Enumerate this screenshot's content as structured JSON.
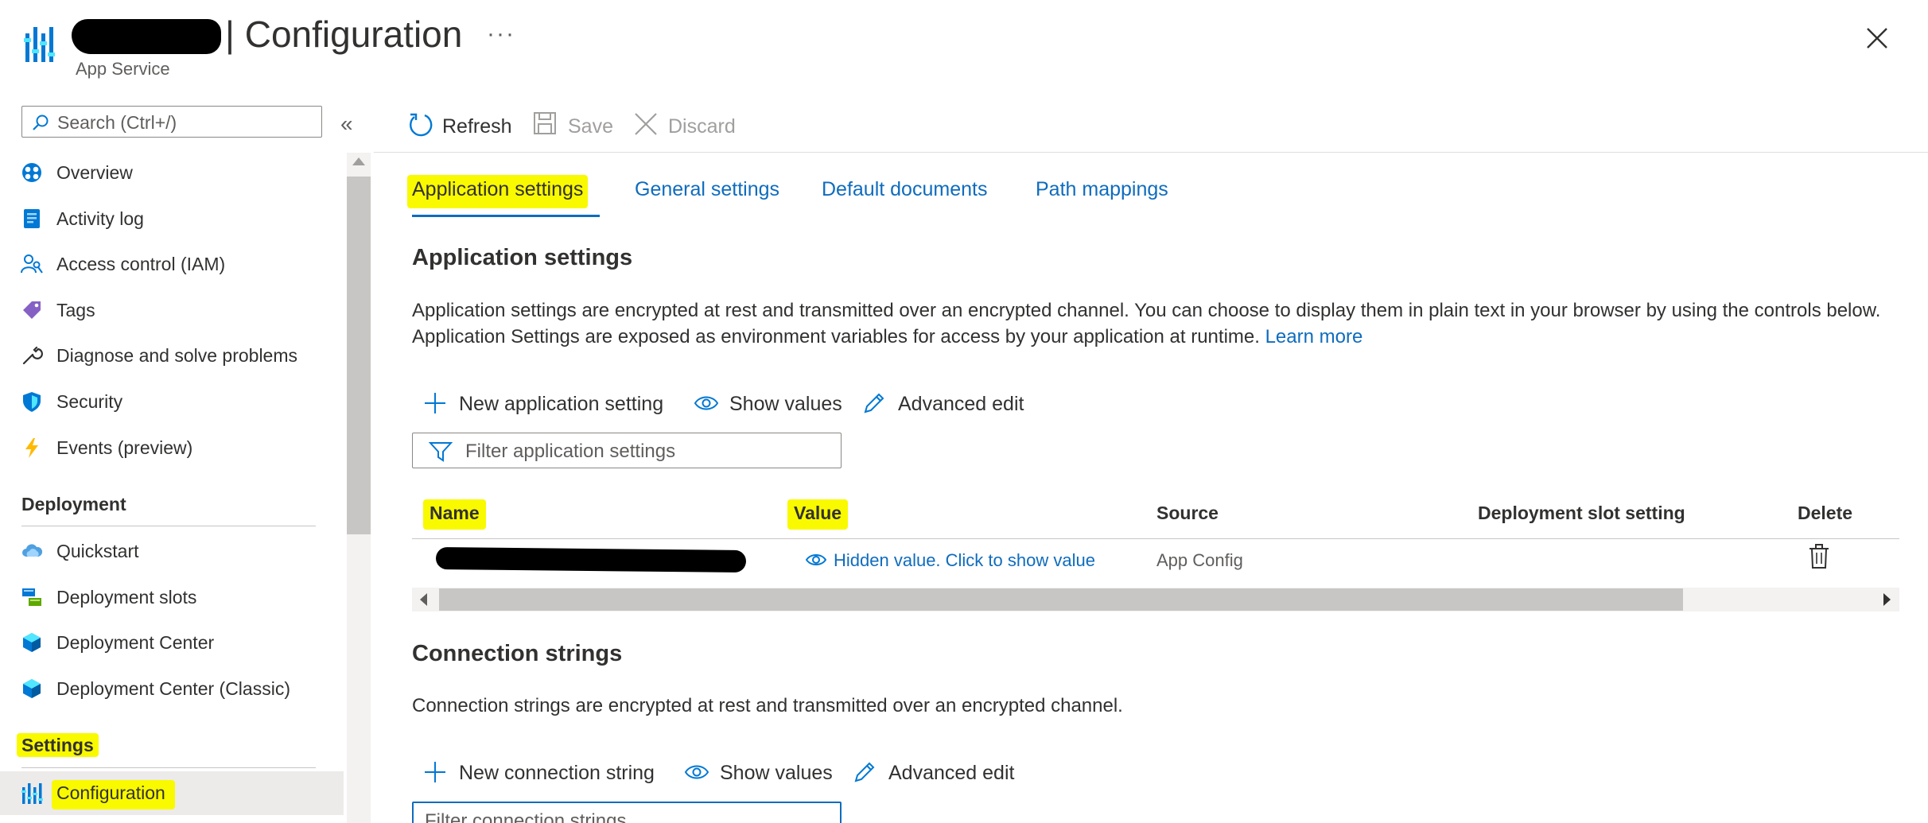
{
  "header": {
    "title": "| Configuration",
    "more": "···",
    "subtitle": "App Service"
  },
  "sidebar": {
    "search_placeholder": "Search (Ctrl+/)",
    "collapse": "«",
    "items": [
      {
        "label": "Overview",
        "icon": "overview-icon"
      },
      {
        "label": "Activity log",
        "icon": "activity-log-icon"
      },
      {
        "label": "Access control (IAM)",
        "icon": "iam-icon"
      },
      {
        "label": "Tags",
        "icon": "tag-icon"
      },
      {
        "label": "Diagnose and solve problems",
        "icon": "wrench-icon"
      },
      {
        "label": "Security",
        "icon": "shield-icon"
      },
      {
        "label": "Events (preview)",
        "icon": "lightning-icon"
      }
    ],
    "deployment_header": "Deployment",
    "deployment_items": [
      {
        "label": "Quickstart",
        "icon": "cloud-icon"
      },
      {
        "label": "Deployment slots",
        "icon": "slots-icon"
      },
      {
        "label": "Deployment Center",
        "icon": "cube-icon"
      },
      {
        "label": "Deployment Center (Classic)",
        "icon": "cube-icon"
      }
    ],
    "settings_header": "Settings",
    "settings_items": [
      {
        "label": "Configuration",
        "icon": "configuration-icon",
        "active": true
      }
    ]
  },
  "toolbar": {
    "refresh": "Refresh",
    "save": "Save",
    "discard": "Discard"
  },
  "tabs": [
    {
      "label": "Application settings",
      "active": true
    },
    {
      "label": "General settings"
    },
    {
      "label": "Default documents"
    },
    {
      "label": "Path mappings"
    }
  ],
  "app_settings": {
    "heading": "Application settings",
    "description": "Application settings are encrypted at rest and transmitted over an encrypted channel. You can choose to display them in plain text in your browser by using the controls below. Application Settings are exposed as environment variables for access by your application at runtime.",
    "learn_more": "Learn more",
    "new_button": "New application setting",
    "show_values": "Show values",
    "advanced_edit": "Advanced edit",
    "filter_placeholder": "Filter application settings",
    "columns": [
      "Name",
      "Value",
      "Source",
      "Deployment slot setting",
      "Delete"
    ],
    "rows": [
      {
        "value": "Hidden value. Click to show value",
        "source": "App Config"
      }
    ]
  },
  "conn_strings": {
    "heading": "Connection strings",
    "description": "Connection strings are encrypted at rest and transmitted over an encrypted channel.",
    "new_button": "New connection string",
    "show_values": "Show values",
    "advanced_edit": "Advanced edit",
    "filter_placeholder": "Filter connection strings"
  },
  "colors": {
    "accent": "#0f6cbd",
    "highlight": "#f9f900"
  }
}
